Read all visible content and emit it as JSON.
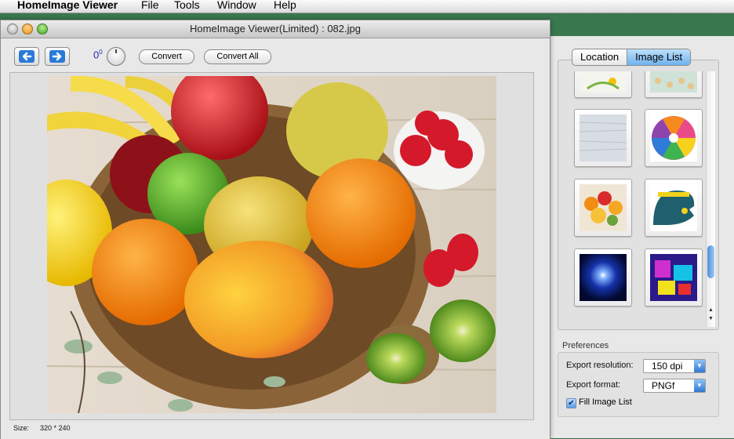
{
  "menubar": {
    "app_name": "HomeImage Viewer",
    "items": [
      "File",
      "Tools",
      "Window",
      "Help"
    ]
  },
  "window": {
    "title": "HomeImage Viewer(Limited) : 082.jpg",
    "toolbar": {
      "rotation_value": "0",
      "rotation_unit": "0",
      "convert_label": "Convert",
      "convert_all_label": "Convert All"
    },
    "status": {
      "size_label": "Size:",
      "size_value": "320 * 240"
    },
    "image": {
      "description_icon": "fruit-basket-photo"
    }
  },
  "panel": {
    "tabs": [
      "Location",
      "Image List"
    ],
    "selected_tab": "Image List",
    "thumbnails": [
      {
        "name": "thumb-cartoon-icon"
      },
      {
        "name": "thumb-pattern-icon"
      },
      {
        "name": "thumb-gray-texture-icon"
      },
      {
        "name": "thumb-spiral-icon"
      },
      {
        "name": "thumb-fruit-icon"
      },
      {
        "name": "thumb-homeimage-logo-icon"
      },
      {
        "name": "thumb-blue-flare-icon"
      },
      {
        "name": "thumb-colorful-abstract-icon"
      }
    ],
    "preferences": {
      "title": "Preferences",
      "resolution_label": "Export resolution:",
      "resolution_value": "150 dpi",
      "format_label": "Export format:",
      "format_value": "PNGf",
      "fill_label": "Fill Image List",
      "fill_checked": true
    }
  },
  "colors": {
    "accent": "#5a9ce8",
    "desktop": "#2f6b46"
  }
}
